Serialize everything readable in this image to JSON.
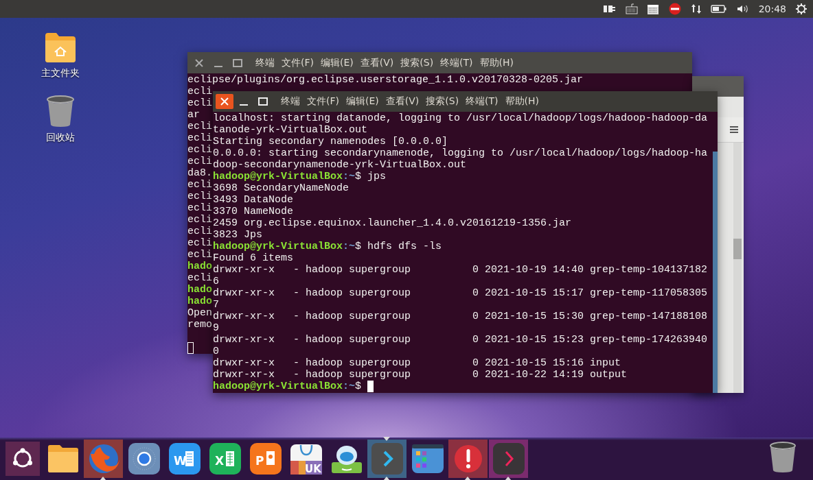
{
  "top_panel": {
    "clock": "20:48"
  },
  "desktop_icons": [
    {
      "kind": "home-folder",
      "label": "主文件夹"
    },
    {
      "kind": "trash",
      "label": "回收站"
    }
  ],
  "windows": [
    {
      "kind": "terminal",
      "focused": false,
      "menu": [
        "终端",
        "文件(F)",
        "编辑(E)",
        "查看(V)",
        "搜索(S)",
        "终端(T)",
        "帮助(H)"
      ],
      "lines": [
        {
          "kind": "text",
          "text": "eclipse/plugins/org.eclipse.userstorage_1.1.0.v20170328-0205.jar"
        },
        {
          "kind": "text",
          "text": "ecli"
        },
        {
          "kind": "text",
          "text": "ecli"
        },
        {
          "kind": "text",
          "text": "ar"
        },
        {
          "kind": "text",
          "text": "ecli"
        },
        {
          "kind": "text",
          "text": "ecli"
        },
        {
          "kind": "text",
          "text": "ecli"
        },
        {
          "kind": "text",
          "text": "ecli"
        },
        {
          "kind": "text",
          "text": "da8."
        },
        {
          "kind": "text",
          "text": "ecli"
        },
        {
          "kind": "text",
          "text": "ecli"
        },
        {
          "kind": "text",
          "text": "ecli"
        },
        {
          "kind": "text",
          "text": "ecli"
        },
        {
          "kind": "text",
          "text": "ecli"
        },
        {
          "kind": "text",
          "text": "ecli"
        },
        {
          "kind": "text",
          "text": "ecli"
        },
        {
          "kind": "prompt",
          "user_host": "hado"
        },
        {
          "kind": "text",
          "text": "ecli"
        },
        {
          "kind": "prompt",
          "user_host": "hado"
        },
        {
          "kind": "prompt",
          "user_host": "hado"
        },
        {
          "kind": "text",
          "text": "Open"
        },
        {
          "kind": "text",
          "text": "remo"
        },
        {
          "kind": "cursor"
        }
      ]
    },
    {
      "kind": "app"
    },
    {
      "kind": "terminal",
      "focused": true,
      "menu": [
        "终端",
        "文件(F)",
        "编辑(E)",
        "查看(V)",
        "搜索(S)",
        "终端(T)",
        "帮助(H)"
      ],
      "lines": [
        {
          "kind": "text",
          "text": "localhost: starting datanode, logging to /usr/local/hadoop/logs/hadoop-hadoop-da"
        },
        {
          "kind": "text",
          "text": "tanode-yrk-VirtualBox.out"
        },
        {
          "kind": "text",
          "text": "Starting secondary namenodes [0.0.0.0]"
        },
        {
          "kind": "text",
          "text": "0.0.0.0: starting secondarynamenode, logging to /usr/local/hadoop/logs/hadoop-ha"
        },
        {
          "kind": "text",
          "text": "doop-secondarynamenode-yrk-VirtualBox.out"
        },
        {
          "kind": "prompt",
          "user_host": "hadoop@yrk-VirtualBox",
          "path": ":~",
          "command": "$ jps"
        },
        {
          "kind": "text",
          "text": "3698 SecondaryNameNode"
        },
        {
          "kind": "text",
          "text": "3493 DataNode"
        },
        {
          "kind": "text",
          "text": "3370 NameNode"
        },
        {
          "kind": "text",
          "text": "2459 org.eclipse.equinox.launcher_1.4.0.v20161219-1356.jar"
        },
        {
          "kind": "text",
          "text": "3823 Jps"
        },
        {
          "kind": "prompt",
          "user_host": "hadoop@yrk-VirtualBox",
          "path": ":~",
          "command": "$ hdfs dfs -ls"
        },
        {
          "kind": "text",
          "text": "Found 6 items"
        },
        {
          "kind": "text",
          "text": "drwxr-xr-x   - hadoop supergroup          0 2021-10-19 14:40 grep-temp-104137182"
        },
        {
          "kind": "text",
          "text": "6"
        },
        {
          "kind": "text",
          "text": "drwxr-xr-x   - hadoop supergroup          0 2021-10-15 15:17 grep-temp-117058305"
        },
        {
          "kind": "text",
          "text": "7"
        },
        {
          "kind": "text",
          "text": "drwxr-xr-x   - hadoop supergroup          0 2021-10-15 15:30 grep-temp-147188108"
        },
        {
          "kind": "text",
          "text": "9"
        },
        {
          "kind": "text",
          "text": "drwxr-xr-x   - hadoop supergroup          0 2021-10-15 15:23 grep-temp-174263940"
        },
        {
          "kind": "text",
          "text": "0"
        },
        {
          "kind": "text",
          "text": "drwxr-xr-x   - hadoop supergroup          0 2021-10-15 15:16 input"
        },
        {
          "kind": "text",
          "text": "drwxr-xr-x   - hadoop supergroup          0 2021-10-22 14:19 output"
        },
        {
          "kind": "prompt",
          "user_host": "hadoop@yrk-VirtualBox",
          "path": ":~",
          "command": "$",
          "cursor": true
        }
      ]
    }
  ],
  "dock": {
    "items": [
      {
        "kind": "ubuntu",
        "running": false,
        "focused": false
      },
      {
        "kind": "folder",
        "running": false,
        "focused": false
      },
      {
        "kind": "firefox",
        "running": true,
        "focused": false,
        "color": "#8b3a3a"
      },
      {
        "kind": "browser",
        "running": false,
        "focused": false
      },
      {
        "kind": "word",
        "glyph": "W",
        "running": false,
        "focused": false
      },
      {
        "kind": "excel",
        "glyph": "X",
        "running": false,
        "focused": false
      },
      {
        "kind": "powerpoint",
        "glyph": "P",
        "running": false,
        "focused": false
      },
      {
        "kind": "shop",
        "glyph": "UK",
        "running": false,
        "focused": false
      },
      {
        "kind": "robot",
        "running": false,
        "focused": false
      },
      {
        "kind": "terminal",
        "running": true,
        "focused": true,
        "color": "#3e6488"
      },
      {
        "kind": "windows",
        "running": false,
        "focused": false
      },
      {
        "kind": "alert",
        "running": true,
        "focused": false,
        "color": "#8c3040"
      },
      {
        "kind": "terminal-pink",
        "running": true,
        "focused": false,
        "color": "#7b2b6e"
      }
    ],
    "trash": {
      "kind": "trash"
    }
  }
}
